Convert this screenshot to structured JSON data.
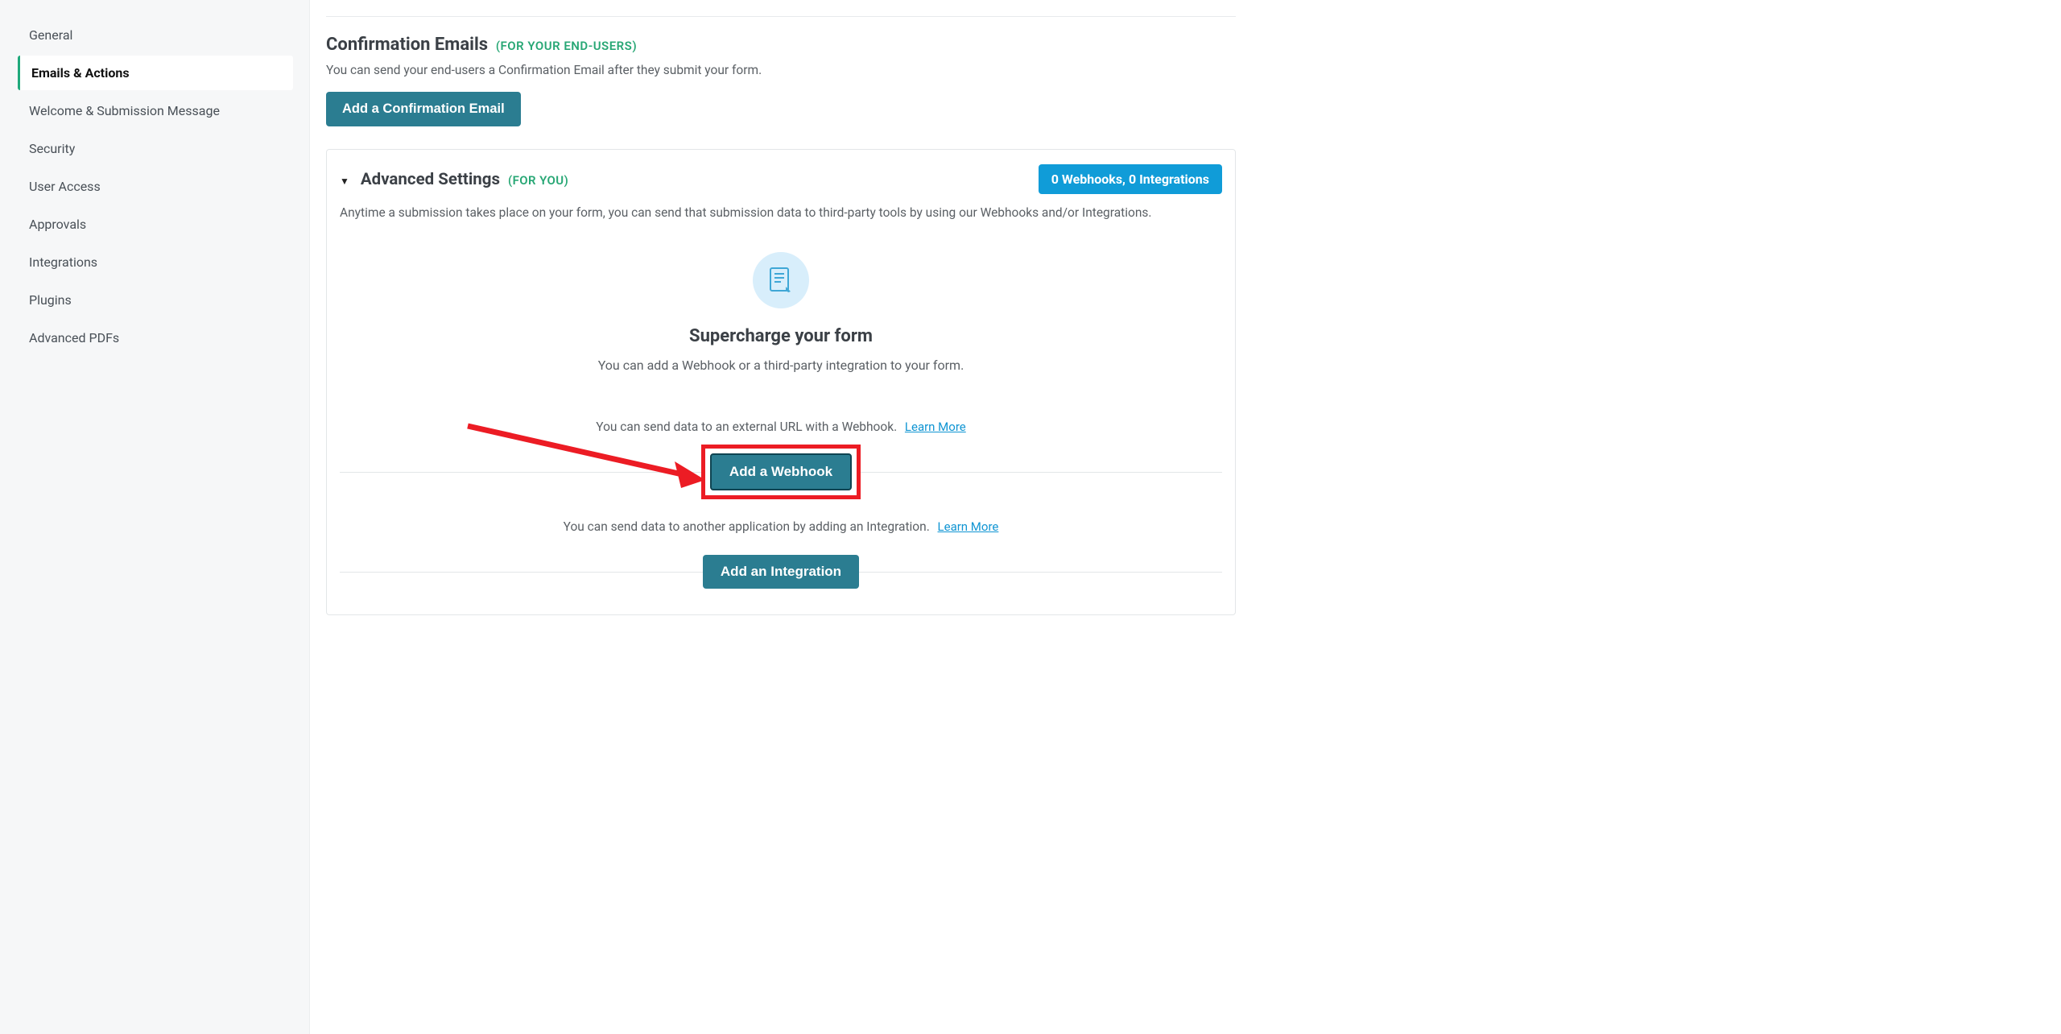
{
  "sidebar": {
    "items": [
      {
        "label": "General"
      },
      {
        "label": "Emails & Actions"
      },
      {
        "label": "Welcome & Submission Message"
      },
      {
        "label": "Security"
      },
      {
        "label": "User Access"
      },
      {
        "label": "Approvals"
      },
      {
        "label": "Integrations"
      },
      {
        "label": "Plugins"
      },
      {
        "label": "Advanced PDFs"
      }
    ],
    "active_index": 1
  },
  "confirmation": {
    "title": "Confirmation Emails",
    "subtitle": "(For your end-users)",
    "desc": "You can send your end-users a Confirmation Email after they submit your form.",
    "button": "Add a Confirmation Email"
  },
  "advanced": {
    "title": "Advanced Settings",
    "subtitle": "(For you)",
    "badge": "0 Webhooks, 0 Integrations",
    "desc": "Anytime a submission takes place on your form, you can send that submission data to third-party tools by using our Webhooks and/or Integrations.",
    "empty_title": "Supercharge your form",
    "empty_lead": "You can add a Webhook or a third-party integration to your form.",
    "webhook_text": "You can send data to an external URL with a Webhook.",
    "webhook_learn": "Learn More",
    "webhook_button": "Add a Webhook",
    "integration_text": "You can send data to another application by adding an Integration.",
    "integration_learn": "Learn More",
    "integration_button": "Add an Integration"
  }
}
